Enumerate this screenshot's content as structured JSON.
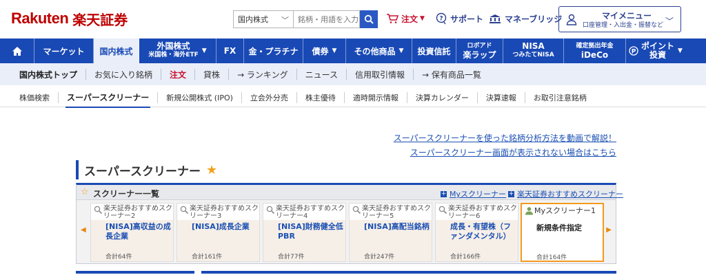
{
  "header": {
    "logo_en": "Rakuten",
    "logo_jp": "楽天証券",
    "search_select": "国内株式",
    "search_placeholder": "銘柄・用語を入力",
    "order_label": "注文",
    "support_label": "サポート",
    "moneybridge_label": "マネーブリッジ",
    "mymenu_title": "マイメニュー",
    "mymenu_sub": "口座管理・入出金・振替など"
  },
  "gnav": [
    {
      "label": "マーケット"
    },
    {
      "label": "国内株式"
    },
    {
      "small": "外国株式",
      "big": "米国株・海外ETF"
    },
    {
      "label": "FX"
    },
    {
      "label": "金・プラチナ"
    },
    {
      "label": "債券"
    },
    {
      "label": "その他商品"
    },
    {
      "label": "投資信託"
    },
    {
      "small": "ロボアド",
      "big": "楽ラップ"
    },
    {
      "small": "NISA",
      "big": "つみたてNISA"
    },
    {
      "small": "確定拠出年金",
      "big": "iDeCo"
    },
    {
      "small": "ポイント",
      "big": "投資"
    }
  ],
  "subnav": [
    "国内株式トップ",
    "お気に入り銘柄",
    "注文",
    "貸株",
    "→ ランキング",
    "ニュース",
    "信用取引情報",
    "→ 保有商品一覧"
  ],
  "tnav": [
    "株価検索",
    "スーパースクリーナー",
    "新規公開株式 (IPO)",
    "立会外分売",
    "株主優待",
    "適時開示情報",
    "決算カレンダー",
    "決算速報",
    "お取引注意銘柄"
  ],
  "links": {
    "video": "スーパースクリーナーを使った銘柄分析方法を動画で解説！",
    "notshown": "スーパースクリーナー画面が表示されない場合はこちら"
  },
  "page_title": "スーパースクリーナー",
  "panel": {
    "title": "スクリーナー一覧",
    "my_link": "Myスクリーナー",
    "rec_link": "楽天証券おすすめスクリーナー"
  },
  "cards": [
    {
      "sub": "楽天証券おすすめスクリーナー2",
      "name": "[NISA]高収益の成長企業",
      "count": "合計64件"
    },
    {
      "sub": "楽天証券おすすめスクリーナー3",
      "name": "[NISA]成長企業",
      "count": "合計161件"
    },
    {
      "sub": "楽天証券おすすめスクリーナー4",
      "name": "[NISA]財務健全低PBR",
      "count": "合計77件"
    },
    {
      "sub": "楽天証券おすすめスクリーナー5",
      "name": "[NISA]高配当銘柄",
      "count": "合計247件"
    },
    {
      "sub": "楽天証券おすすめスクリーナー6",
      "name": "成長・有望株（ファンダメンタル）",
      "count": "合計166件"
    },
    {
      "sub": "Myスクリーナー1",
      "name": "新規条件指定",
      "count": "合計164件"
    }
  ]
}
